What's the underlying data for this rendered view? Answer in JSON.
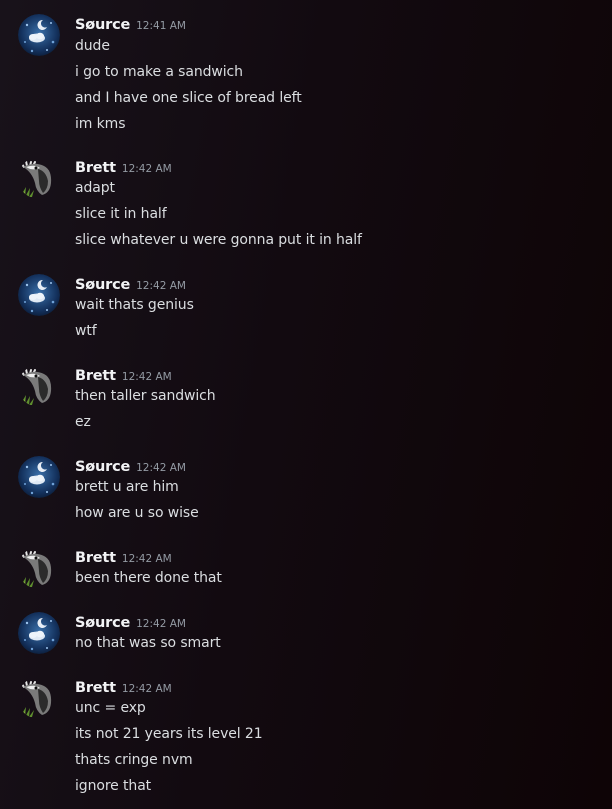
{
  "users": {
    "source": {
      "name": "Søurce",
      "avatar_icon": "night-moon-avatar-icon",
      "color": "#f2f3f5"
    },
    "brett": {
      "name": "Brett",
      "avatar_icon": "bird-grass-avatar-icon",
      "color": "#f2f3f5"
    }
  },
  "messages": [
    {
      "author": "Søurce",
      "time": "12:41 AM",
      "lines": [
        "dude",
        "i go to make a sandwich",
        "and I have one slice of bread left",
        "im kms"
      ]
    },
    {
      "author": "Brett",
      "time": "12:42 AM",
      "lines": [
        "adapt",
        "slice it in half",
        "slice whatever u were gonna put it in half"
      ]
    },
    {
      "author": "Søurce",
      "time": "12:42 AM",
      "lines": [
        "wait thats genius",
        "wtf"
      ]
    },
    {
      "author": "Brett",
      "time": "12:42 AM",
      "lines": [
        "then taller sandwich",
        "ez"
      ]
    },
    {
      "author": "Søurce",
      "time": "12:42 AM",
      "lines": [
        "brett u are him",
        "how are u so wise"
      ]
    },
    {
      "author": "Brett",
      "time": "12:42 AM",
      "lines": [
        "been there done that"
      ]
    },
    {
      "author": "Søurce",
      "time": "12:42 AM",
      "lines": [
        "no that was so smart"
      ]
    },
    {
      "author": "Brett",
      "time": "12:42 AM",
      "lines": [
        "unc = exp",
        "its not 21 years its level 21",
        "thats cringe nvm",
        "ignore that"
      ]
    }
  ]
}
